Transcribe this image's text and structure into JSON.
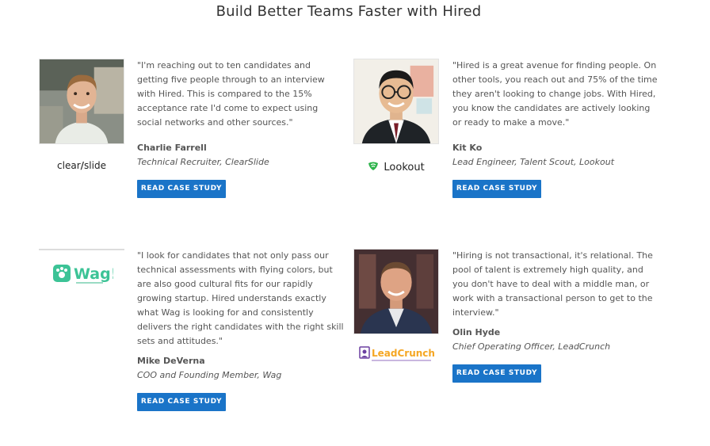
{
  "page": {
    "title": "Build Better Teams Faster with Hired"
  },
  "testimonials": [
    {
      "quote": "\"I'm reaching out to ten candidates and getting five people through to an interview with Hired. This is compared to the 15% acceptance rate I'd come to expect using social networks and other sources.\"",
      "name": "Charlie Farrell",
      "role": "Technical Recruiter, ClearSlide",
      "company_logo": "clearslide",
      "button": "READ CASE STUDY"
    },
    {
      "quote": "\"Hired is a great avenue for finding people. On other tools, you reach out and 75% of the time they aren't looking to change jobs. With Hired, you know the candidates are actively looking or ready to make a move.\"",
      "name": "Kit Ko",
      "role": "Lead Engineer, Talent Scout, Lookout",
      "company_logo": "Lookout",
      "button": "READ CASE STUDY"
    },
    {
      "quote": "\"I look for candidates that not only pass our technical assessments with flying colors, but are also good cultural fits for our rapidly growing startup. Hired understands exactly what Wag is looking for and consistently delivers the right candidates with the right skill sets and attitudes.\"",
      "name": "Mike DeVerna",
      "role": "COO and Founding Member, Wag",
      "company_logo": "Wag!",
      "button": "READ CASE STUDY"
    },
    {
      "quote": "\"Hiring is not transactional, it's relational. The pool of talent is extremely high quality, and you don't have to deal with a middle man, or work with a transactional person to get to the interview.\"",
      "name": "Olin Hyde",
      "role": "Chief Operating Officer, LeadCrunch",
      "company_logo": "LeadCrunch",
      "button": "READ CASE STUDY"
    }
  ],
  "colors": {
    "button": "#1a74c8",
    "lookout_green": "#2db34a",
    "wag_green": "#3cc396",
    "leadcrunch_orange": "#f5a623",
    "leadcrunch_purple": "#6b3fa0"
  }
}
